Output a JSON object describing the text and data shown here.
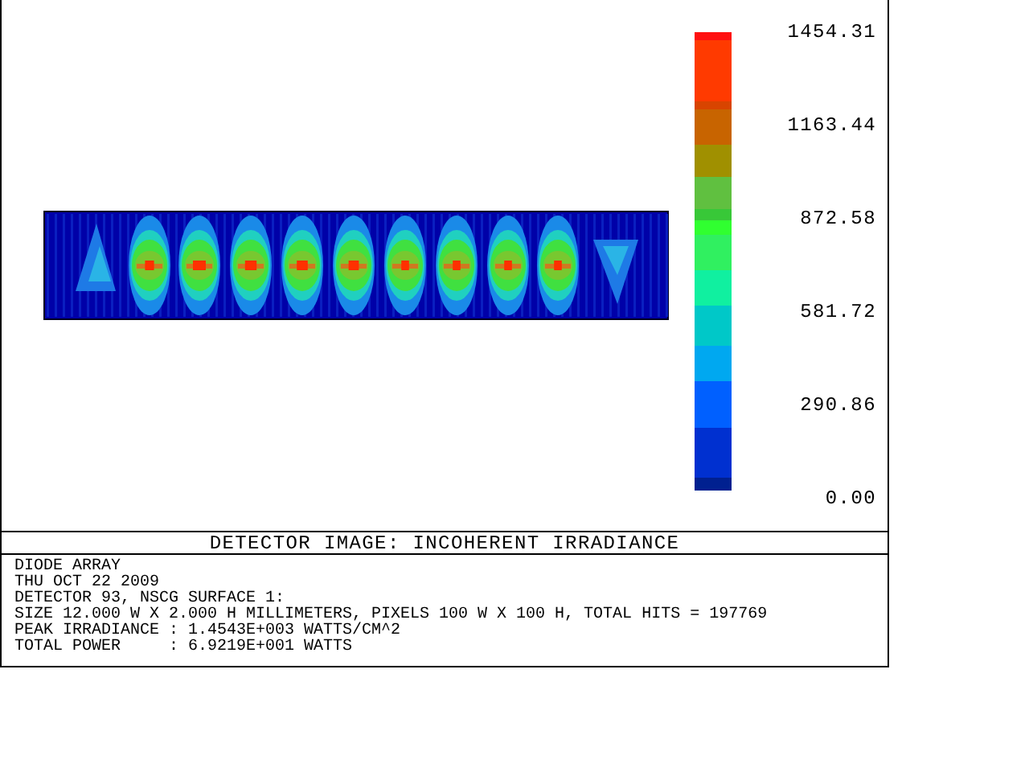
{
  "scale_labels": [
    "1454.31",
    "1163.44",
    "872.58",
    "581.72",
    "290.86",
    "0.00"
  ],
  "title": "DETECTOR IMAGE: INCOHERENT IRRADIANCE",
  "info_lines": [
    "DIODE ARRAY",
    "THU OCT 22 2009",
    "DETECTOR 93, NSCG SURFACE 1:",
    "SIZE 12.000 W X 2.000 H MILLIMETERS, PIXELS 100 W X 100 H, TOTAL HITS = 197769",
    "PEAK IRRADIANCE : 1.4543E+003 WATTS/CM^2",
    "TOTAL POWER     : 6.9219E+001 WATTS"
  ]
}
